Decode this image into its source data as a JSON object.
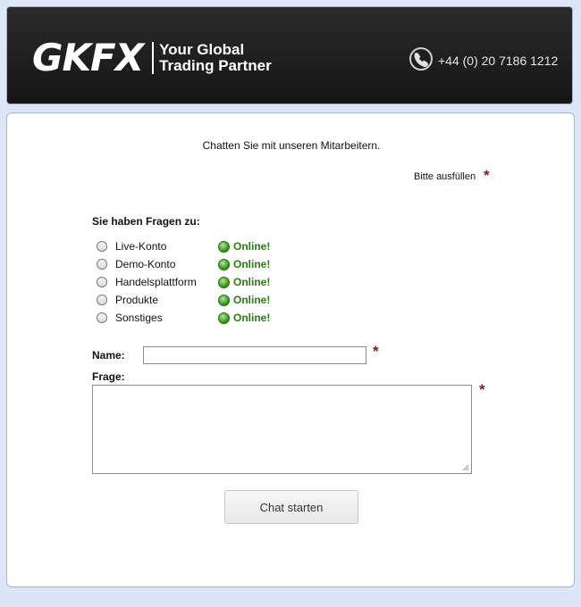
{
  "header": {
    "logo_mark": "GKFX",
    "tagline_line1": "Your Global",
    "tagline_line2": "Trading Partner",
    "phone_icon": "phone-icon",
    "phone_number": "+44 (0) 20 7186 1212"
  },
  "form": {
    "intro": "Chatten Sie mit unseren Mitarbeitern.",
    "required_note": "Bitte ausfüllen",
    "required_marker": "*",
    "questions_title": "Sie haben Fragen zu:",
    "topics": [
      {
        "label": "Live-Konto",
        "status": "Online!"
      },
      {
        "label": "Demo-Konto",
        "status": "Online!"
      },
      {
        "label": "Handelsplattform",
        "status": "Online!"
      },
      {
        "label": "Produkte",
        "status": "Online!"
      },
      {
        "label": "Sonstiges",
        "status": "Online!"
      }
    ],
    "name_label": "Name:",
    "name_value": "",
    "question_label": "Frage:",
    "question_value": "",
    "submit_label": "Chat starten"
  },
  "colors": {
    "header_bg": "#1c1c1c",
    "page_bg": "#dce6f7",
    "online_green": "#2b7a14",
    "required_red": "#8b1a1a"
  }
}
